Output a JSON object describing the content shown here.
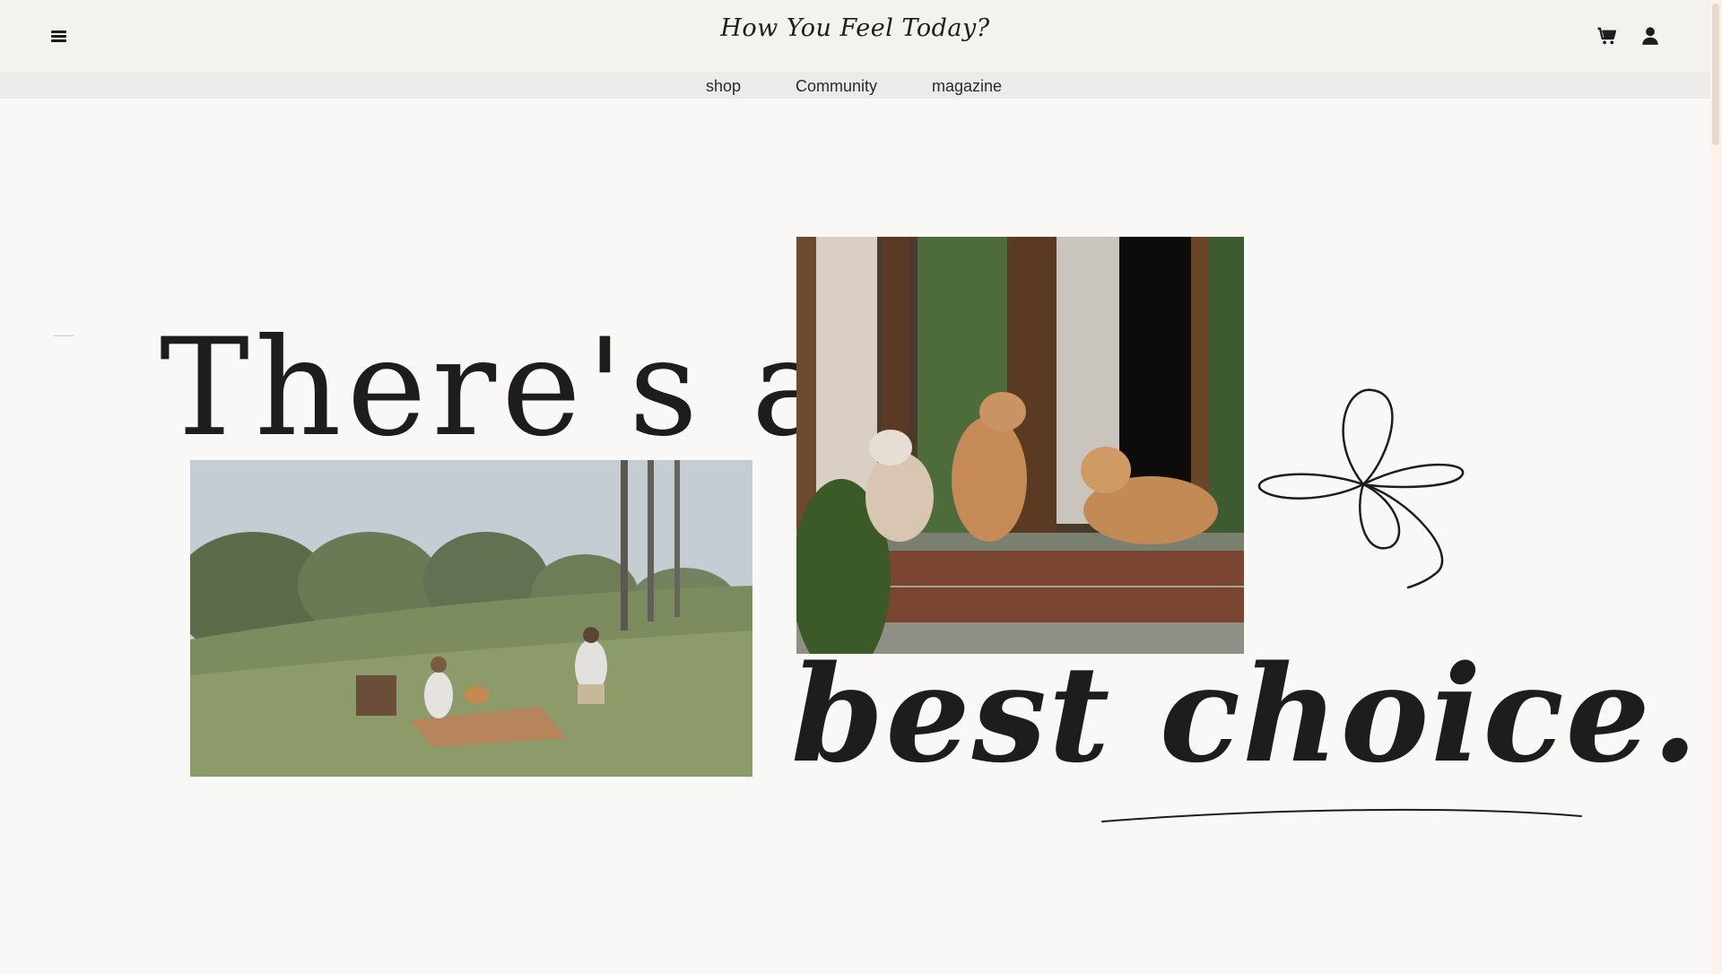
{
  "header": {
    "logo": "How You Feel Today?",
    "menu_icon": "hamburger-menu-icon",
    "cart_icon": "cart-icon",
    "user_icon": "user-icon"
  },
  "nav": {
    "items": [
      {
        "label": "shop"
      },
      {
        "label": "Community"
      },
      {
        "label": "magazine"
      }
    ]
  },
  "hero": {
    "line1": "There's a",
    "line2": "best choice."
  },
  "colors": {
    "background": "#f9f8f6",
    "header_bg": "#f3f2ee",
    "nav_bg": "#ecebea",
    "text": "#1e1d1d"
  }
}
